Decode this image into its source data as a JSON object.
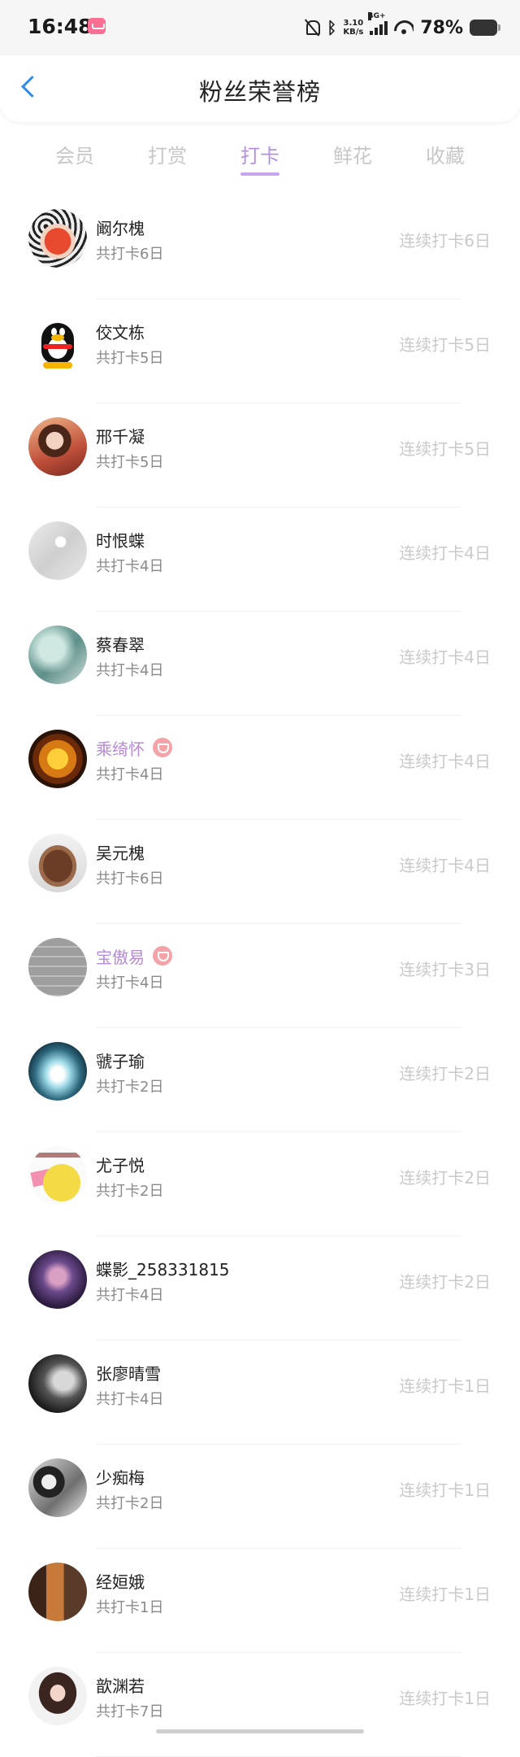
{
  "status_bar": {
    "time": "16:48",
    "net_speed_value": "3.10",
    "net_speed_unit": "KB/s",
    "signal_type": "4G+",
    "battery": "78%"
  },
  "header": {
    "title": "粉丝荣誉榜"
  },
  "tabs": [
    {
      "label": "会员"
    },
    {
      "label": "打赏"
    },
    {
      "label": "打卡",
      "active": true
    },
    {
      "label": "鲜花"
    },
    {
      "label": "收藏"
    }
  ],
  "colors": {
    "accent": "#b590e0",
    "back": "#2c8ae8",
    "vip_name": "#b58ad6"
  },
  "fans": [
    {
      "name": "阚尔槐",
      "total": "共打卡6日",
      "streak": "连续打卡6日",
      "vip": false
    },
    {
      "name": "佼文栋",
      "total": "共打卡5日",
      "streak": "连续打卡5日",
      "vip": false
    },
    {
      "name": "邢千凝",
      "total": "共打卡5日",
      "streak": "连续打卡5日",
      "vip": false
    },
    {
      "name": "时恨蝶",
      "total": "共打卡4日",
      "streak": "连续打卡4日",
      "vip": false
    },
    {
      "name": "蔡春翠",
      "total": "共打卡4日",
      "streak": "连续打卡4日",
      "vip": false
    },
    {
      "name": "乘绮怀",
      "total": "共打卡4日",
      "streak": "连续打卡4日",
      "vip": true
    },
    {
      "name": "吴元槐",
      "total": "共打卡6日",
      "streak": "连续打卡4日",
      "vip": false
    },
    {
      "name": "宝傲易",
      "total": "共打卡4日",
      "streak": "连续打卡3日",
      "vip": true
    },
    {
      "name": "虢子瑜",
      "total": "共打卡2日",
      "streak": "连续打卡2日",
      "vip": false
    },
    {
      "name": "尤子悦",
      "total": "共打卡2日",
      "streak": "连续打卡2日",
      "vip": false
    },
    {
      "name": "蝶影_258331815",
      "total": "共打卡4日",
      "streak": "连续打卡2日",
      "vip": false
    },
    {
      "name": "张廖晴雪",
      "total": "共打卡4日",
      "streak": "连续打卡1日",
      "vip": false
    },
    {
      "name": "少痴梅",
      "total": "共打卡2日",
      "streak": "连续打卡1日",
      "vip": false
    },
    {
      "name": "经姮娥",
      "total": "共打卡1日",
      "streak": "连续打卡1日",
      "vip": false
    },
    {
      "name": "歆渊若",
      "total": "共打卡7日",
      "streak": "连续打卡1日",
      "vip": false
    }
  ]
}
